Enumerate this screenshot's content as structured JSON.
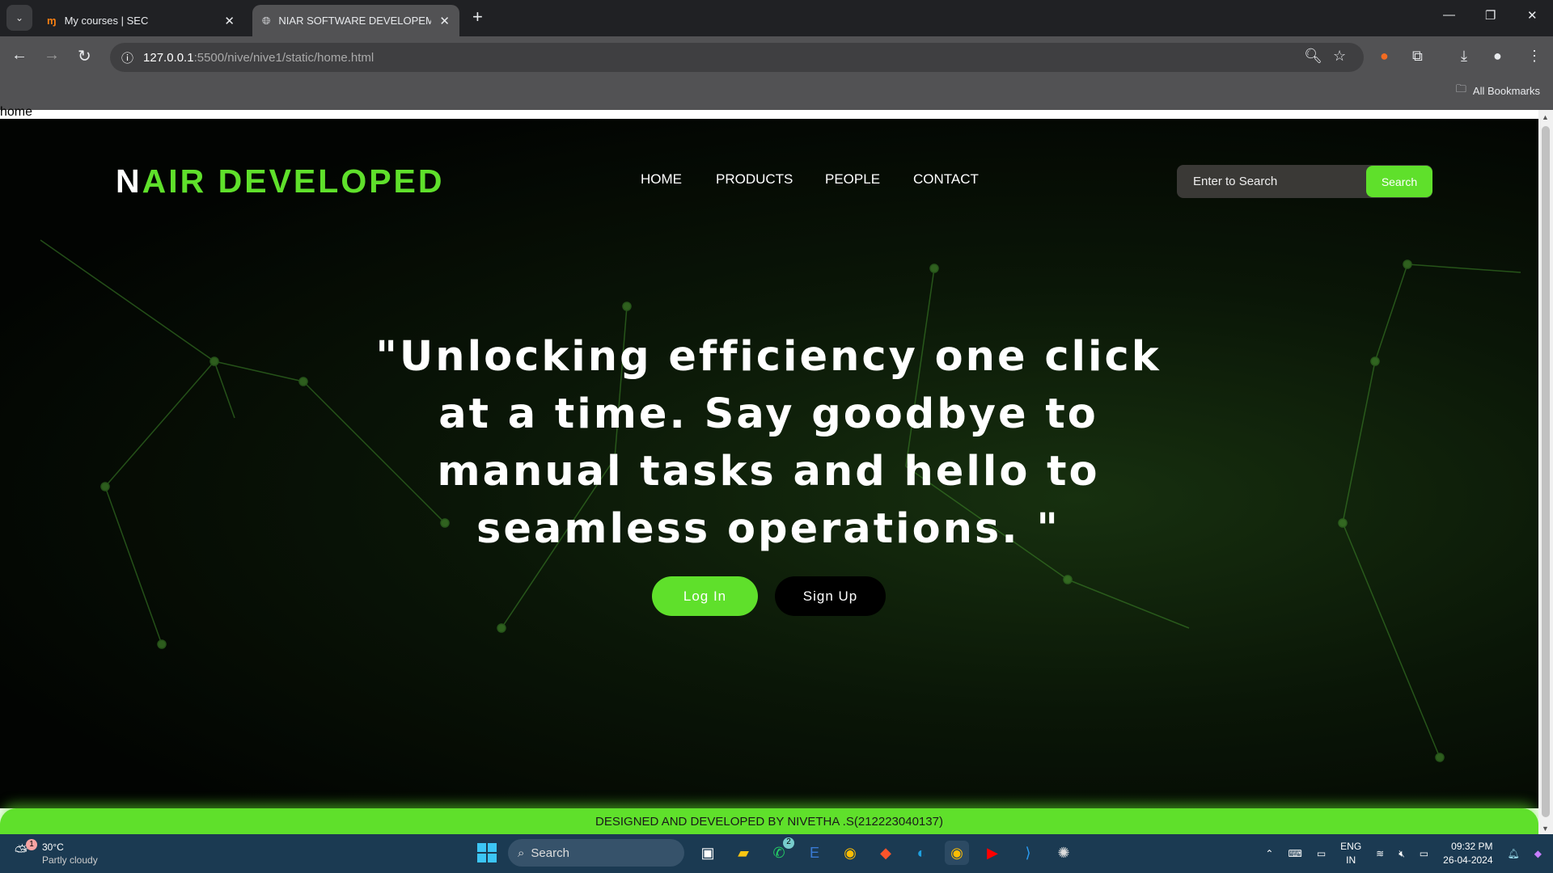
{
  "browser": {
    "tabs": [
      {
        "title": "My courses | SEC",
        "icon": "moodle-icon"
      },
      {
        "title": "NIAR SOFTWARE DEVELOPEMENT",
        "icon": "globe-icon",
        "active": true
      }
    ],
    "url_host": "127.0.0.1",
    "url_path": ":5500/nive/nive1/static/home.html",
    "bookmarks_label": "All Bookmarks"
  },
  "page": {
    "breadcrumb": "home",
    "logo": {
      "part1": "N",
      "part2": "AIR",
      "part3": "DEVELOPED"
    },
    "nav": [
      "HOME",
      "PRODUCTS",
      "PEOPLE",
      "CONTACT"
    ],
    "search": {
      "placeholder": "Enter to Search",
      "button": "Search"
    },
    "quote": "\"Unlocking efficiency one click at a time. Say goodbye to manual tasks and hello to seamless operations. \"",
    "login": "Log In",
    "signup": "Sign Up",
    "footer": "DESIGNED AND DEVELOPED BY NIVETHA .S(212223040137)",
    "accent": "#5fe02b"
  },
  "taskbar": {
    "weather_temp": "30°C",
    "weather_desc": "Partly cloudy",
    "weather_badge": "1",
    "search": "Search",
    "whatsapp_badge": "2",
    "lang1": "ENG",
    "lang2": "IN",
    "time": "09:32 PM",
    "date": "26-04-2024"
  }
}
